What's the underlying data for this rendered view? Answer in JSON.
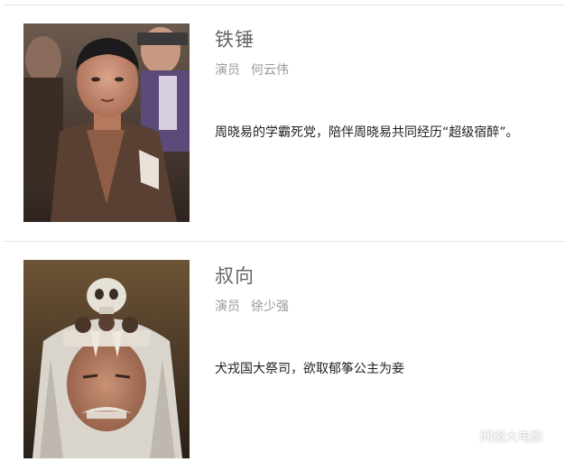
{
  "characters": [
    {
      "name": "铁锤",
      "role_label": "演员",
      "actor": "何云伟",
      "description": "周晓易的学霸死党，陪伴周晓易共同经历“超级宿醉”。"
    },
    {
      "name": "叔向",
      "role_label": "演员",
      "actor": "徐少强",
      "description": "犬戎国大祭司，欲取郁筝公主为妾"
    }
  ],
  "watermark": {
    "text": "网络大电影",
    "icon": "wechat-icon"
  },
  "colors": {
    "name": "#666666",
    "role": "#999999",
    "description": "#222222",
    "divider": "#e6e6e6"
  }
}
